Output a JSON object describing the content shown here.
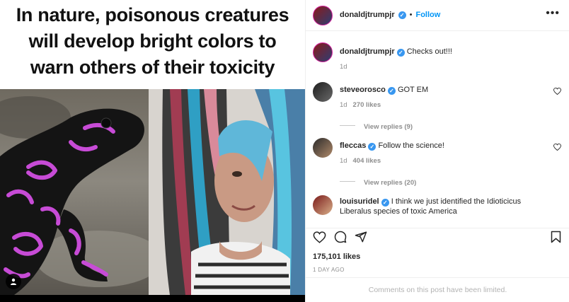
{
  "meme": {
    "caption_lines": [
      "In nature, poisonous creatures",
      "will develop bright colors to",
      "warn others of their toxicity"
    ]
  },
  "post": {
    "author": "donaldjtrumpjr",
    "follow_label": "Follow",
    "separator": "•",
    "caption": {
      "username": "donaldjtrumpjr",
      "text": "Checks out!!!",
      "time": "1d"
    },
    "comments": [
      {
        "username": "steveorosco",
        "text": "GOT EM",
        "time": "1d",
        "likes": "270 likes",
        "replies": "View replies (9)"
      },
      {
        "username": "fleccas",
        "text": "Follow the science!",
        "time": "1d",
        "likes": "404 likes",
        "replies": "View replies (20)"
      },
      {
        "username": "louisuridel",
        "text_line1": "I think we just identified the Idioticicus",
        "text_line2": "Liberalus species of toxic America"
      }
    ],
    "likes": "175,101 likes",
    "date": "1 DAY AGO",
    "comments_limited": "Comments on this post have been limited."
  },
  "icons": {
    "verified": "✓",
    "more": "•••"
  },
  "colors": {
    "accent": "#0095f6",
    "verified": "#3897f0",
    "muted": "#8e8e8e",
    "frog_pink": "#c74bd6"
  }
}
